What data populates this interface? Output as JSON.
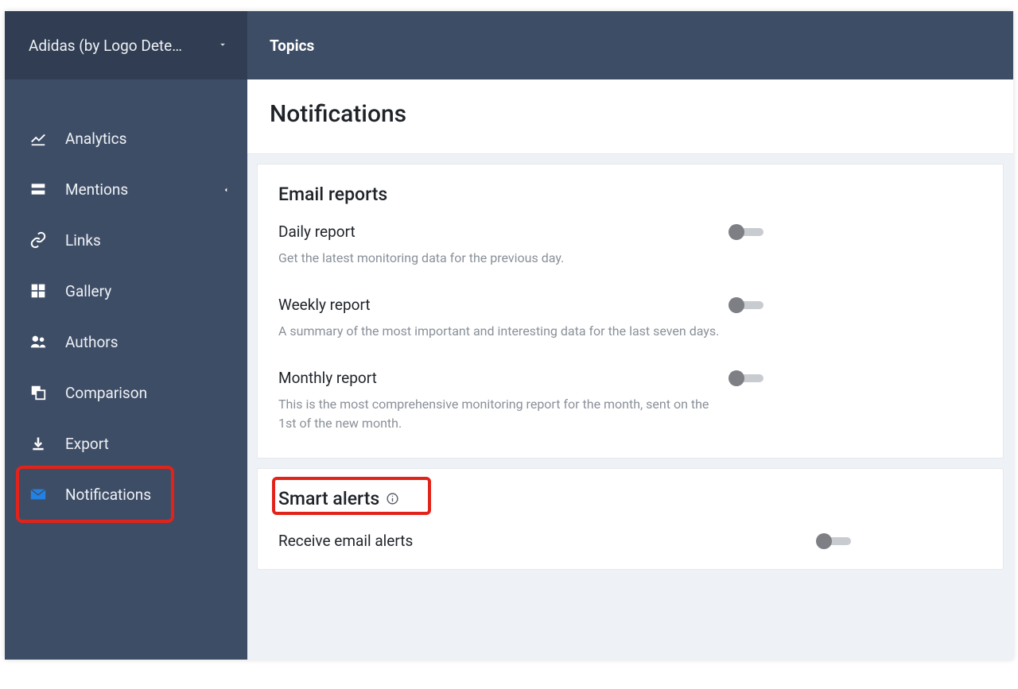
{
  "project": {
    "name": "Adidas (by Logo Dete…"
  },
  "topbar": {
    "title": "Topics"
  },
  "sidebar": {
    "items": [
      {
        "label": "Analytics"
      },
      {
        "label": "Mentions"
      },
      {
        "label": "Links"
      },
      {
        "label": "Gallery"
      },
      {
        "label": "Authors"
      },
      {
        "label": "Comparison"
      },
      {
        "label": "Export"
      },
      {
        "label": "Notifications"
      }
    ]
  },
  "page": {
    "title": "Notifications"
  },
  "email_reports": {
    "heading": "Email reports",
    "daily": {
      "title": "Daily report",
      "desc": "Get the latest monitoring data for the previous day."
    },
    "weekly": {
      "title": "Weekly report",
      "desc": "A summary of the most important and interesting data for the last seven days."
    },
    "monthly": {
      "title": "Monthly report",
      "desc": "This is the most comprehensive monitoring report for the month, sent on the 1st of the new month."
    }
  },
  "smart_alerts": {
    "heading": "Smart alerts",
    "receive": {
      "title": "Receive email alerts"
    }
  }
}
